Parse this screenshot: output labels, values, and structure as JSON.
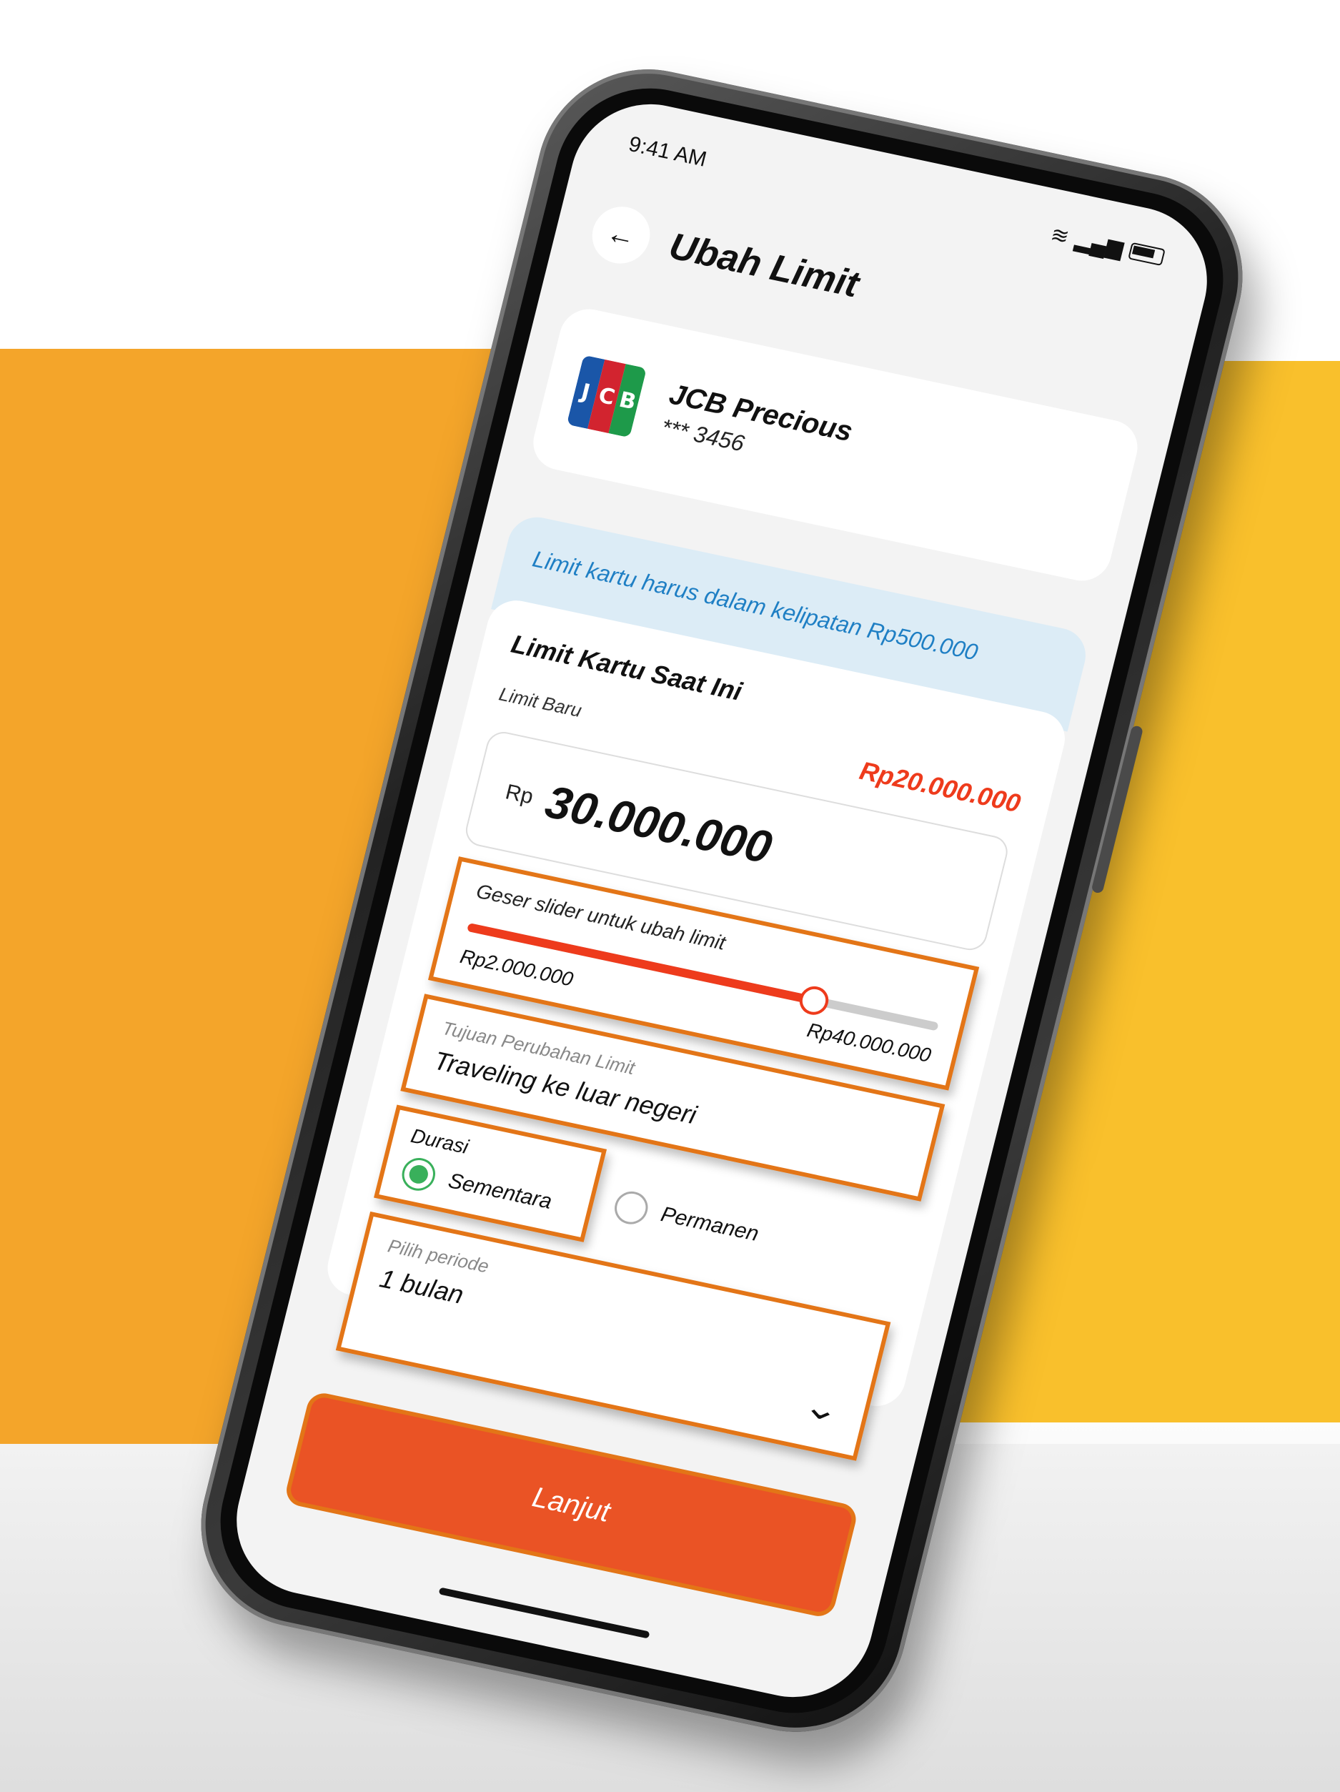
{
  "status": {
    "time": "9:41 AM"
  },
  "header": {
    "title": "Ubah Limit"
  },
  "card": {
    "name": "JCB Precious",
    "number": "*** 3456",
    "logo_letters": [
      "J",
      "C",
      "B"
    ]
  },
  "info": {
    "text": "Limit kartu harus dalam kelipatan Rp500.000"
  },
  "form": {
    "title": "Limit Kartu Saat Ini",
    "new_limit_label": "Limit Baru",
    "current_limit_value": "Rp20.000.000",
    "amount_prefix": "Rp",
    "amount_value": "30.000.000",
    "slider": {
      "hint": "Geser slider untuk ubah limit",
      "min_label": "Rp2.000.000",
      "max_label": "Rp40.000.000",
      "fraction": 0.737
    },
    "purpose": {
      "label": "Tujuan Perubahan Limit",
      "value": "Traveling ke luar negeri"
    },
    "duration": {
      "label": "Durasi",
      "options": [
        {
          "label": "Sementara",
          "selected": true
        },
        {
          "label": "Permanen",
          "selected": false
        }
      ]
    },
    "period": {
      "label": "Pilih periode",
      "value": "1 bulan"
    }
  },
  "cta": {
    "label": "Lanjut"
  },
  "colors": {
    "accent": "#ea5325",
    "highlight": "#e37517",
    "info_text": "#1f7fc4",
    "success": "#39b05b"
  }
}
